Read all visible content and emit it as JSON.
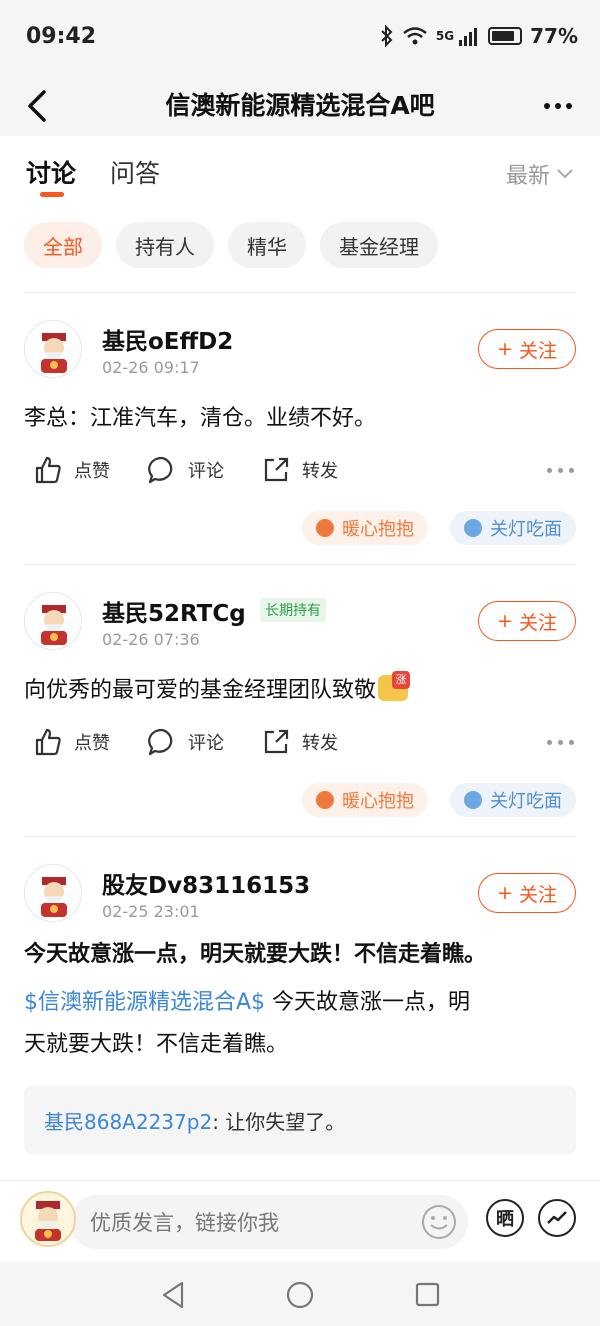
{
  "status_bar": {
    "time": "09:42",
    "network": "5G",
    "battery": "77%"
  },
  "header": {
    "title": "信澳新能源精选混合A吧"
  },
  "tabs": [
    {
      "label": "讨论",
      "active": true
    },
    {
      "label": "问答",
      "active": false
    }
  ],
  "sort": {
    "label": "最新"
  },
  "filters": [
    {
      "label": "全部",
      "active": true
    },
    {
      "label": "持有人",
      "active": false
    },
    {
      "label": "精华",
      "active": false
    },
    {
      "label": "基金经理",
      "active": false
    }
  ],
  "actions": {
    "like": "点赞",
    "comment": "评论",
    "share": "转发",
    "follow": "关注",
    "follow_prefix": "+"
  },
  "reactions": {
    "warm_hug": "暖心抱抱",
    "lights_off": "关灯吃面"
  },
  "posts": [
    {
      "username": "基民oEffD2",
      "time": "02-26 09:17",
      "text": "李总：江准汽车，清仓。业绩不好。"
    },
    {
      "username": "基民52RTCg",
      "badge": "长期持有",
      "time": "02-26 07:36",
      "text": "向优秀的最可爱的基金经理团队致敬",
      "emoji_label": "涨"
    },
    {
      "username": "股友Dv83116153",
      "time": "02-25 23:01",
      "title": "今天故意涨一点，明天就要大跌！不信走着瞧。",
      "topic": "$信澳新能源精选混合A$",
      "text_line1": " 今天故意涨一点，明",
      "text_line2": "天就要大跌！不信走着瞧。",
      "reply": {
        "user": "基民868A2237p2",
        "text": ": 让你失望了。"
      }
    }
  ],
  "bottom_bar": {
    "placeholder": "优质发言，链接你我",
    "share_btn": "晒"
  },
  "colors": {
    "accent": "#f5571f",
    "link": "#3b86d8",
    "badge_green": "#2e9e48"
  }
}
